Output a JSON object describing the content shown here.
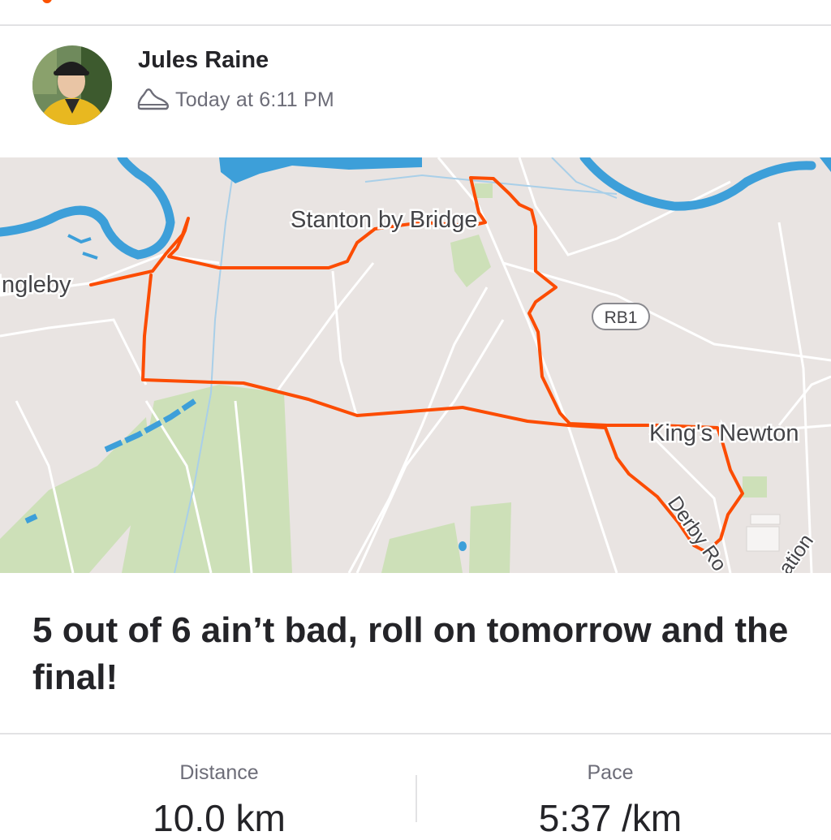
{
  "post": {
    "athlete_name": "Jules Raine",
    "activity_icon": "shoe-icon",
    "timestamp": "Today at 6:11 PM",
    "title": "5 out of 6 ain’t bad, roll on tomorrow and the final!"
  },
  "map": {
    "place_labels": {
      "stanton": "Stanton by Bridge",
      "ingleby": "Ingleby",
      "kings_newton": "King's Newton",
      "derby_road": "Derby Ro",
      "station": "ation"
    },
    "road_badge": "RB1",
    "route_color": "#fc4c02",
    "water_color": "#3d9fd9",
    "land_color": "#e9e4e2",
    "park_color": "#cde0b8"
  },
  "stats": {
    "distance": {
      "label": "Distance",
      "value": "10.0 km"
    },
    "pace": {
      "label": "Pace",
      "value": "5:37 /km"
    }
  },
  "colors": {
    "accent": "#fc5200",
    "text_primary": "#242428",
    "text_secondary": "#6d6d78"
  }
}
